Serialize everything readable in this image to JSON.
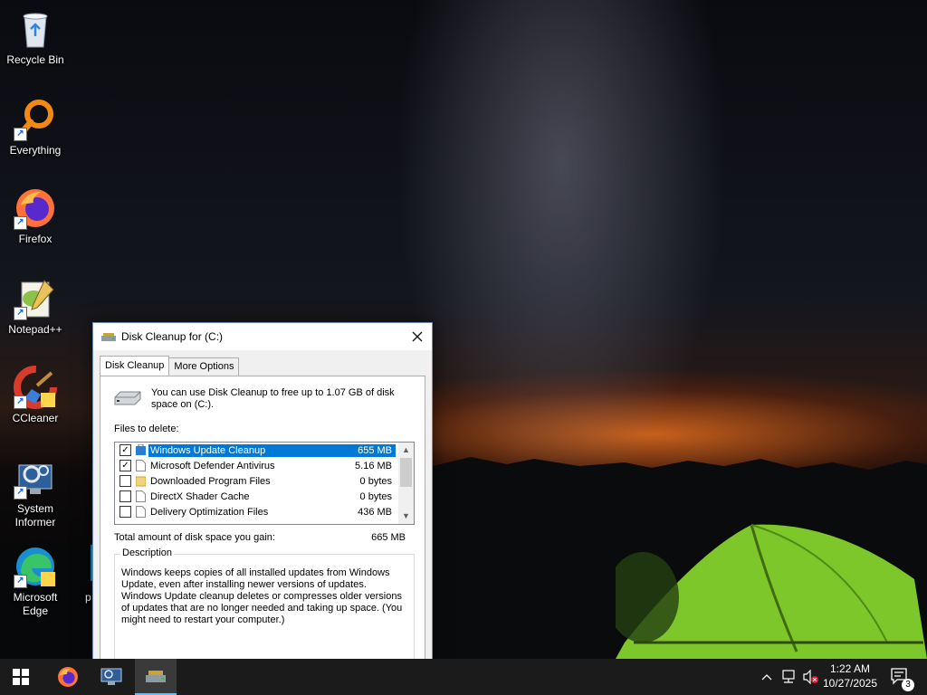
{
  "desktop": {
    "icons": [
      {
        "label": "Recycle Bin"
      },
      {
        "label": "Everything"
      },
      {
        "label": "Firefox"
      },
      {
        "label": "Notepad++"
      },
      {
        "label": "CCleaner"
      },
      {
        "label": "System Informer"
      },
      {
        "label": "Microsoft Edge"
      },
      {
        "label": "p"
      }
    ]
  },
  "dialog": {
    "title": "Disk Cleanup for  (C:)",
    "tabs": [
      {
        "label": "Disk Cleanup",
        "active": true
      },
      {
        "label": "More Options",
        "active": false
      }
    ],
    "intro": "You can use Disk Cleanup to free up to 1.07 GB of disk space on  (C:).",
    "files_to_delete_label": "Files to delete:",
    "files": [
      {
        "name": "Windows Update Cleanup",
        "size": "655 MB",
        "checked": true,
        "selected": true,
        "icon": "windows-update-icon"
      },
      {
        "name": "Microsoft Defender Antivirus",
        "size": "5.16 MB",
        "checked": true,
        "selected": false,
        "icon": "file-icon"
      },
      {
        "name": "Downloaded Program Files",
        "size": "0 bytes",
        "checked": false,
        "selected": false,
        "icon": "folder-icon"
      },
      {
        "name": "DirectX Shader Cache",
        "size": "0 bytes",
        "checked": false,
        "selected": false,
        "icon": "file-icon"
      },
      {
        "name": "Delivery Optimization Files",
        "size": "436 MB",
        "checked": false,
        "selected": false,
        "icon": "file-icon"
      }
    ],
    "total_label": "Total amount of disk space you gain:",
    "total_value": "665 MB",
    "description_label": "Description",
    "description_text": "Windows keeps copies of all installed updates from Windows Update, even after installing newer versions of updates. Windows Update cleanup deletes or compresses older versions of updates that are no longer needed and taking up space. (You might need to restart your computer.)"
  },
  "taskbar": {
    "pinned": [
      {
        "name": "start-button",
        "icon": "windows-logo-icon"
      },
      {
        "name": "taskbar-firefox",
        "icon": "firefox-icon"
      },
      {
        "name": "taskbar-system-informer",
        "icon": "system-informer-icon"
      },
      {
        "name": "taskbar-disk-cleanup",
        "icon": "disk-cleanup-icon",
        "active": true
      }
    ],
    "tray": {
      "time": "1:22 AM",
      "date": "10/27/2025",
      "notification_count": "3"
    }
  },
  "colors": {
    "selection": "#0078d7",
    "taskbar": "#1b1b1b",
    "tent": "#8fd631"
  }
}
